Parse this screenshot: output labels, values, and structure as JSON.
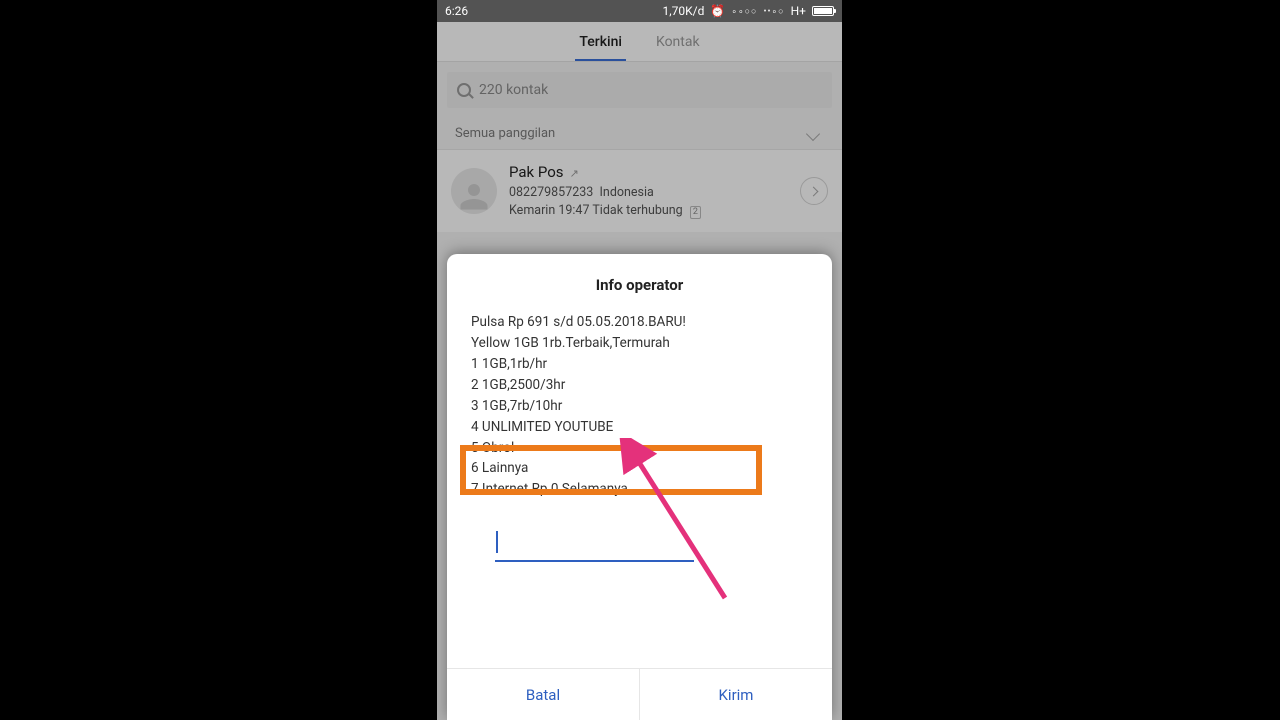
{
  "status": {
    "time": "6:26",
    "speed": "1,70K/d",
    "net": "H+"
  },
  "tabs": {
    "active": "Terkini",
    "inactive": "Kontak"
  },
  "search": {
    "placeholder": "220 kontak"
  },
  "filter": {
    "label": "Semua panggilan"
  },
  "call": {
    "name": "Pak Pos",
    "number": "082279857233",
    "country": "Indonesia",
    "time": "Kemarin 19:47",
    "status": "Tidak terhubung",
    "sim": "2"
  },
  "modal": {
    "title": "Info operator",
    "lines": [
      "Pulsa Rp 691 s/d 05.05.2018.BARU!",
      "Yellow 1GB 1rb.Terbaik,Termurah",
      "1 1GB,1rb/hr",
      "2 1GB,2500/3hr",
      "3 1GB,7rb/10hr",
      "4 UNLIMITED YOUTUBE",
      "5 Obrol",
      "6 Lainnya",
      "7 Internet Rp 0 Selamanya"
    ],
    "cancel": "Batal",
    "send": "Kirim"
  }
}
